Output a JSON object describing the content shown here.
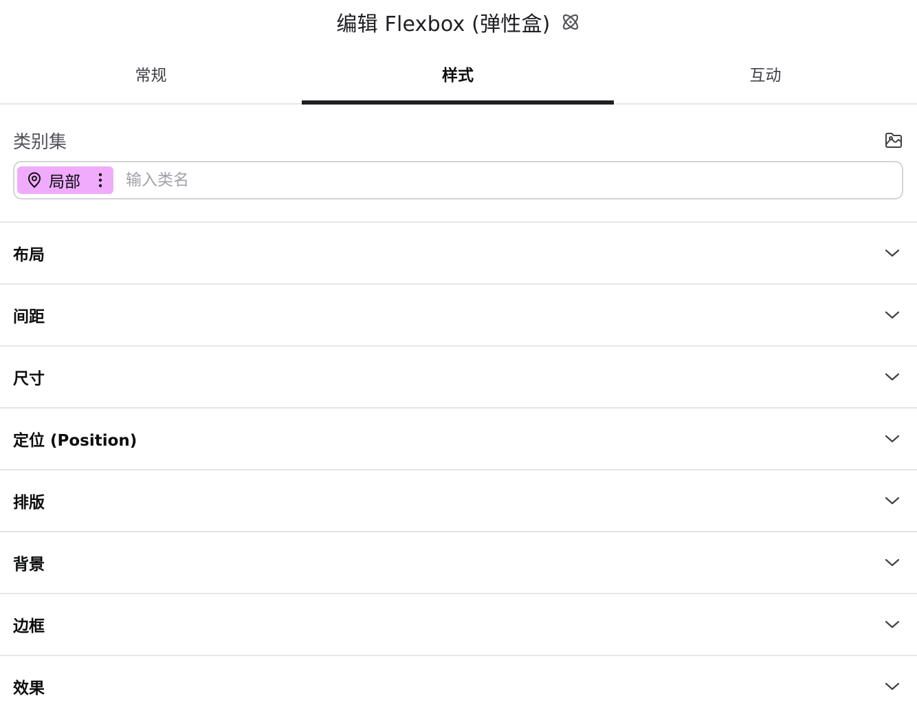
{
  "header": {
    "title": "编辑 Flexbox (弹性盒)",
    "icon": "atom-icon"
  },
  "tabs": [
    {
      "label": "常规",
      "active": false
    },
    {
      "label": "样式",
      "active": true
    },
    {
      "label": "互动",
      "active": false
    }
  ],
  "classes": {
    "label": "类别集",
    "manager_icon": "class-manager-icon",
    "chip": {
      "label": "局部",
      "icon": "location-pin-icon",
      "color": "#f0abfc"
    },
    "input_placeholder": "输入类名",
    "input_value": ""
  },
  "sections": [
    {
      "title": "布局"
    },
    {
      "title": "间距"
    },
    {
      "title": "尺寸"
    },
    {
      "title": "定位 (Position)"
    },
    {
      "title": "排版"
    },
    {
      "title": "背景"
    },
    {
      "title": "边框"
    },
    {
      "title": "效果"
    }
  ],
  "colors": {
    "accent": "#1f1f23",
    "chip_bg": "#f0abfc",
    "divider": "#e6e6e9"
  }
}
